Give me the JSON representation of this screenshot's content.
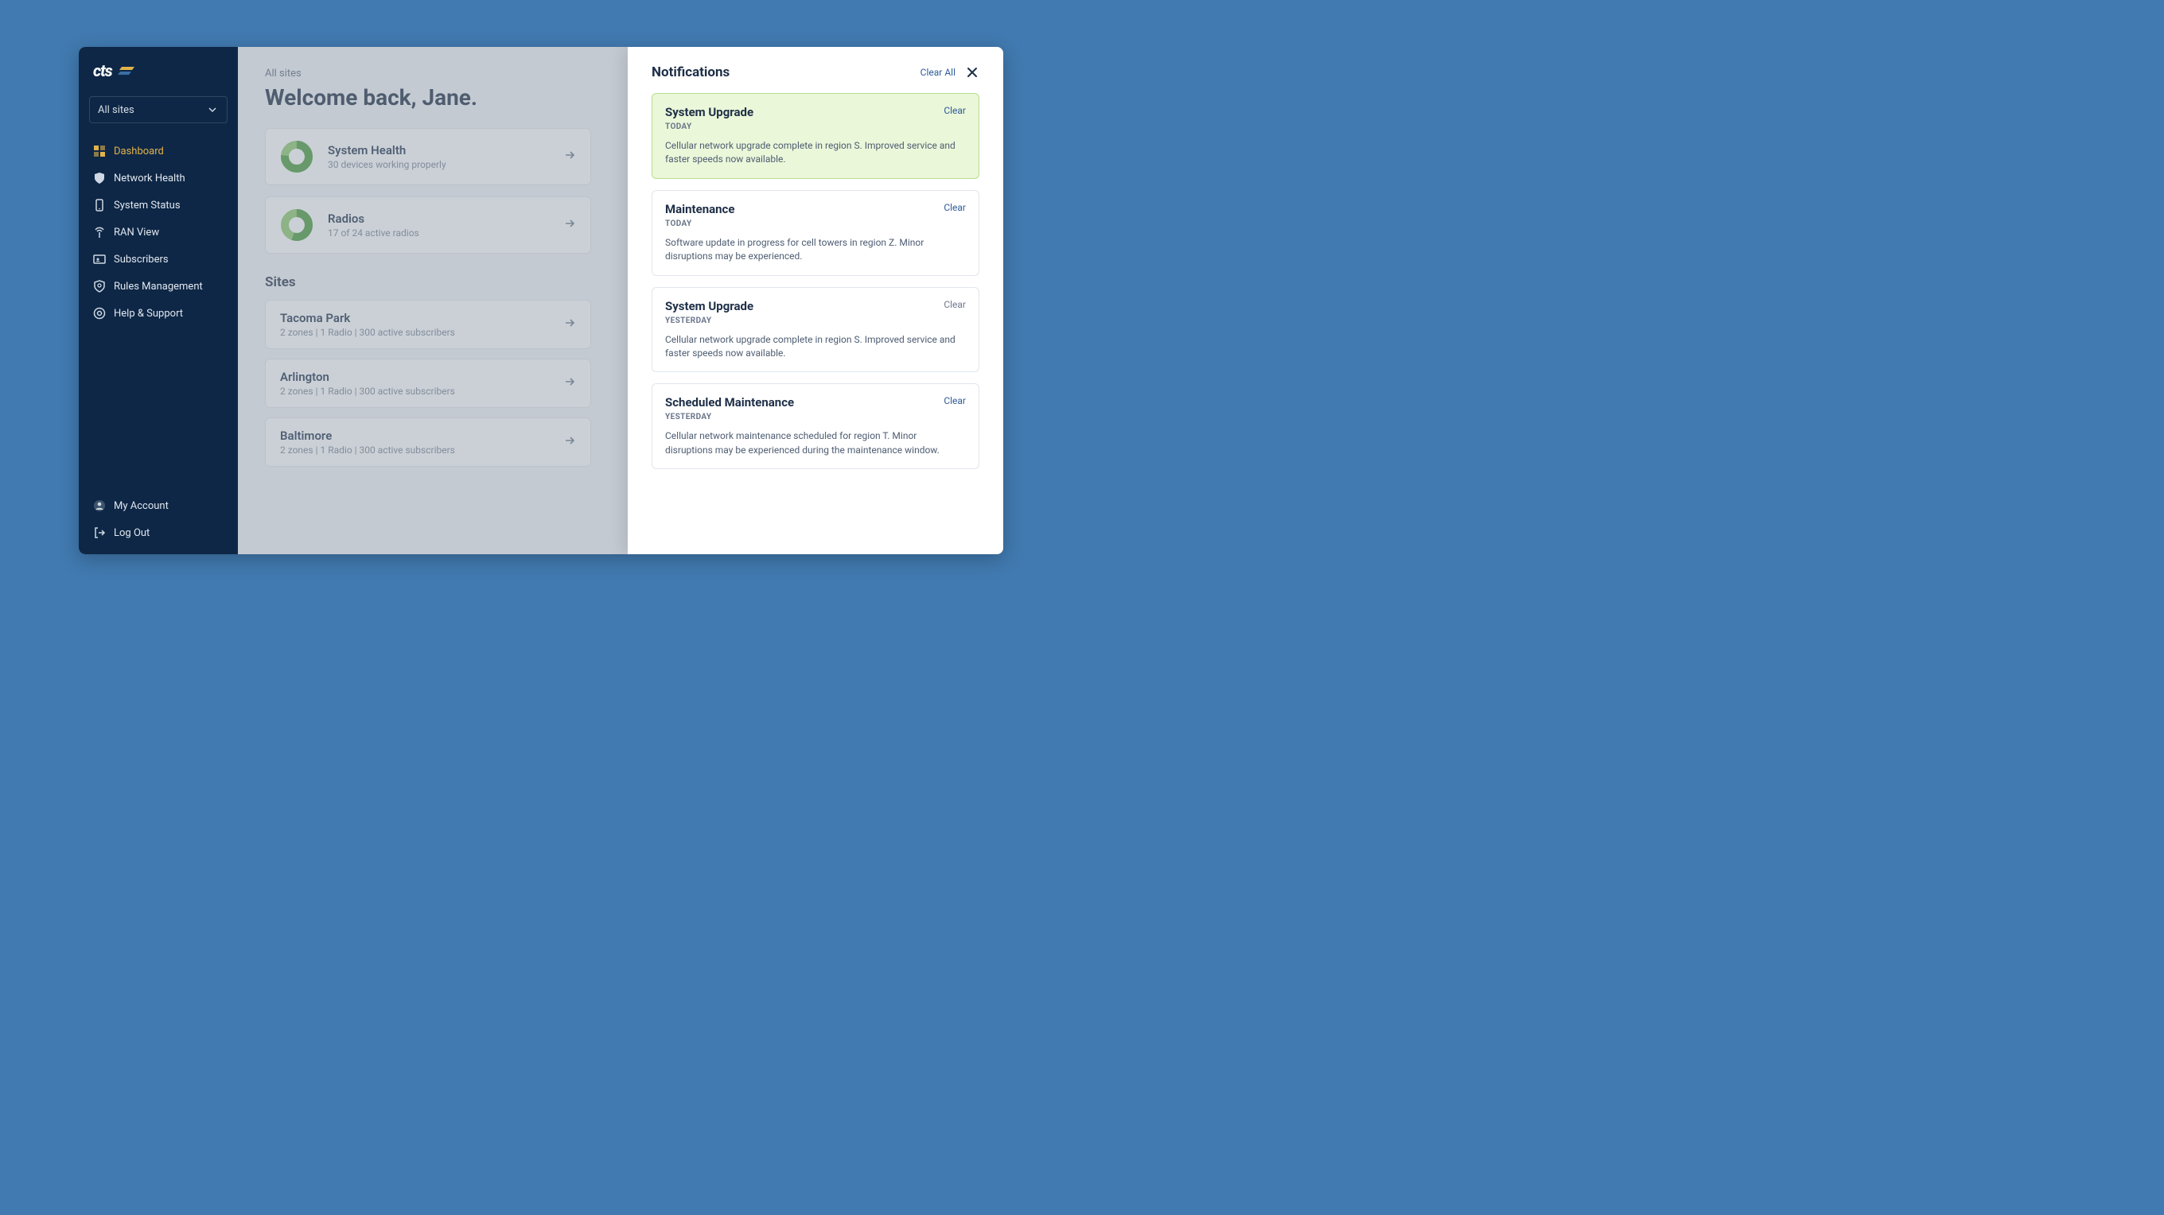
{
  "sidebar": {
    "logo_text": "cts",
    "site_selector": "All sites",
    "nav": [
      {
        "label": "Dashboard",
        "icon": "dashboard",
        "active": true
      },
      {
        "label": "Network Health",
        "icon": "shield"
      },
      {
        "label": "System Status",
        "icon": "mobile"
      },
      {
        "label": "RAN View",
        "icon": "antenna"
      },
      {
        "label": "Subscribers",
        "icon": "users"
      },
      {
        "label": "Rules Management",
        "icon": "settings-shield"
      },
      {
        "label": "Help & Support",
        "icon": "help"
      }
    ],
    "footer": [
      {
        "label": "My Account",
        "icon": "account"
      },
      {
        "label": "Log Out",
        "icon": "logout"
      }
    ]
  },
  "main": {
    "crumb": "All sites",
    "welcome": "Welcome back, Jane.",
    "cards": [
      {
        "title": "System Health",
        "sub": "30 devices working properly"
      },
      {
        "title": "Radios",
        "sub": "17 of 24 active radios"
      }
    ],
    "sites_heading": "Sites",
    "sites": [
      {
        "title": "Tacoma Park",
        "sub": "2 zones  |  1 Radio  |  300 active subscribers"
      },
      {
        "title": "Arlington",
        "sub": "2 zones  |  1 Radio  |  300 active subscribers"
      },
      {
        "title": "Baltimore",
        "sub": "2 zones  |  1 Radio  |  300 active subscribers"
      }
    ]
  },
  "notifications": {
    "title": "Notifications",
    "clear_all": "Clear All",
    "clear_label": "Clear",
    "items": [
      {
        "title": "System Upgrade",
        "when": "TODAY",
        "body": "Cellular network upgrade complete in region S. Improved service and faster speeds now available.",
        "highlight": true
      },
      {
        "title": "Maintenance",
        "when": "TODAY",
        "body": "Software update in progress for cell towers in region Z. Minor disruptions may be experienced."
      },
      {
        "title": "System Upgrade",
        "when": "YESTERDAY",
        "body": "Cellular network upgrade complete in region S. Improved service and faster speeds now available.",
        "muted_clear": true
      },
      {
        "title": "Scheduled Maintenance",
        "when": "YESTERDAY",
        "body": "Cellular network maintenance scheduled for region T. Minor disruptions may be experienced during the maintenance window."
      }
    ]
  }
}
